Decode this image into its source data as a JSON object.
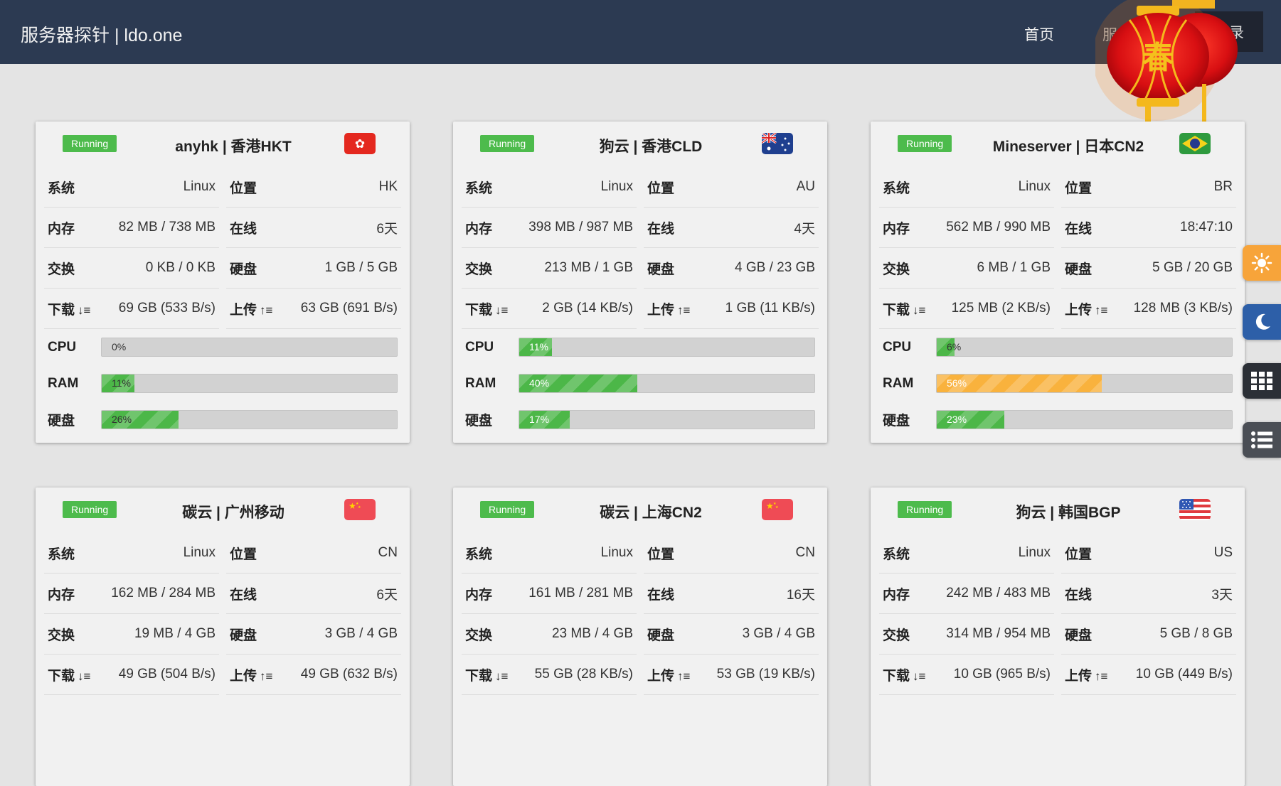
{
  "header": {
    "brand": "服务器探针 | ldo.one",
    "nav_home": "首页",
    "nav_server": "服务",
    "login": "登录",
    "lantern_text": "春"
  },
  "labels": {
    "os": "系统",
    "location": "位置",
    "memory": "内存",
    "online": "在线",
    "swap": "交换",
    "disk": "硬盘",
    "download": "下载",
    "upload": "上传",
    "cpu": "CPU",
    "ram": "RAM",
    "disk_meter": "硬盘",
    "download_icon": "↓≡",
    "upload_icon": "↑≡"
  },
  "servers": [
    {
      "status": "Running",
      "name": "anyhk | 香港HKT",
      "flag": "hk-flag",
      "os": "Linux",
      "location": "HK",
      "memory": "82 MB / 738 MB",
      "online": "6天",
      "swap": "0 KB / 0 KB",
      "disk": "1 GB / 5 GB",
      "download": "69 GB (533 B/s)",
      "upload": "63 GB (691 B/s)",
      "cpu": "0%",
      "ram": "11%",
      "disk_pct": "26%",
      "cpu_v": 0,
      "ram_v": 11,
      "disk_v": 26,
      "ram_color": "#4cb748"
    },
    {
      "status": "Running",
      "name": "狗云 | 香港CLD",
      "flag": "au-flag",
      "os": "Linux",
      "location": "AU",
      "memory": "398 MB / 987 MB",
      "online": "4天",
      "swap": "213 MB / 1 GB",
      "disk": "4 GB / 23 GB",
      "download": "2 GB (14 KB/s)",
      "upload": "1 GB (11 KB/s)",
      "cpu": "11%",
      "ram": "40%",
      "disk_pct": "17%",
      "cpu_v": 11,
      "ram_v": 40,
      "disk_v": 17,
      "ram_color": "#4cb748"
    },
    {
      "status": "Running",
      "name": "Mineserver | 日本CN2",
      "flag": "br-flag",
      "os": "Linux",
      "location": "BR",
      "memory": "562 MB / 990 MB",
      "online": "18:47:10",
      "swap": "6 MB / 1 GB",
      "disk": "5 GB / 20 GB",
      "download": "125 MB (2 KB/s)",
      "upload": "128 MB (3 KB/s)",
      "cpu": "6%",
      "ram": "56%",
      "disk_pct": "23%",
      "cpu_v": 6,
      "ram_v": 56,
      "disk_v": 23,
      "ram_color": "#f9b23d"
    },
    {
      "status": "Running",
      "name": "碳云 | 广州移动",
      "flag": "cn-flag",
      "os": "Linux",
      "location": "CN",
      "memory": "162 MB / 284 MB",
      "online": "6天",
      "swap": "19 MB / 4 GB",
      "disk": "3 GB / 4 GB",
      "download": "49 GB (504 B/s)",
      "upload": "49 GB (632 B/s)"
    },
    {
      "status": "Running",
      "name": "碳云 | 上海CN2",
      "flag": "cn-flag",
      "os": "Linux",
      "location": "CN",
      "memory": "161 MB / 281 MB",
      "online": "16天",
      "swap": "23 MB / 4 GB",
      "disk": "3 GB / 4 GB",
      "download": "55 GB (28 KB/s)",
      "upload": "53 GB (19 KB/s)"
    },
    {
      "status": "Running",
      "name": "狗云 | 韩国BGP",
      "flag": "us-flag",
      "os": "Linux",
      "location": "US",
      "memory": "242 MB / 483 MB",
      "online": "3天",
      "swap": "314 MB / 954 MB",
      "disk": "5 GB / 8 GB",
      "download": "10 GB (965 B/s)",
      "upload": "10 GB (449 B/s)"
    }
  ],
  "side_buttons": [
    "sun-icon",
    "moon-icon",
    "grid-icon",
    "list-icon"
  ],
  "colors": {
    "navbar": "#2c3a52",
    "running": "#4dbb4c",
    "bar_ok": "#4cb748",
    "bar_warn": "#f9b23d"
  }
}
